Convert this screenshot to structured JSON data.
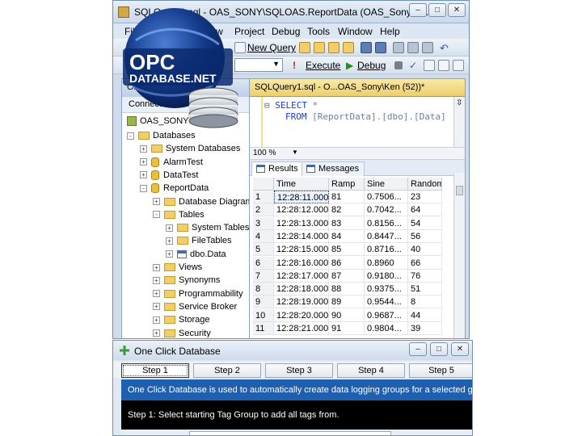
{
  "ssms": {
    "title": "SQLQuery1.sql - OAS_SONY\\SQLOAS.ReportData (OAS_Sony\\Ke...",
    "window_buttons": {
      "minimize": "–",
      "maximize": "□",
      "close": "✕"
    },
    "menu": [
      "File",
      "View",
      "Project",
      "Debug",
      "Tools",
      "Window",
      "Help"
    ],
    "toolbar1": {
      "new_query": "New Query"
    },
    "toolbar2": {
      "execute": "Execute",
      "debug": "Debug"
    },
    "object_explorer": {
      "header": "Object Explorer",
      "connect": "Connect",
      "server": "OAS_SONY\\SQLOAS",
      "tree": [
        {
          "label": "Databases",
          "indent": 0,
          "icon": "folder",
          "exp": "-"
        },
        {
          "label": "System Databases",
          "indent": 1,
          "icon": "folder",
          "exp": "+"
        },
        {
          "label": "AlarmTest",
          "indent": 1,
          "icon": "db",
          "exp": "+"
        },
        {
          "label": "DataTest",
          "indent": 1,
          "icon": "db",
          "exp": "+"
        },
        {
          "label": "ReportData",
          "indent": 1,
          "icon": "db",
          "exp": "-"
        },
        {
          "label": "Database Diagrams",
          "indent": 2,
          "icon": "folder",
          "exp": "+"
        },
        {
          "label": "Tables",
          "indent": 2,
          "icon": "folder",
          "exp": "-"
        },
        {
          "label": "System Tables",
          "indent": 3,
          "icon": "folder",
          "exp": "+"
        },
        {
          "label": "FileTables",
          "indent": 3,
          "icon": "folder",
          "exp": "+"
        },
        {
          "label": "dbo.Data",
          "indent": 3,
          "icon": "table",
          "exp": "+"
        },
        {
          "label": "Views",
          "indent": 2,
          "icon": "folder",
          "exp": "+"
        },
        {
          "label": "Synonyms",
          "indent": 2,
          "icon": "folder",
          "exp": "+"
        },
        {
          "label": "Programmability",
          "indent": 2,
          "icon": "folder",
          "exp": "+"
        },
        {
          "label": "Service Broker",
          "indent": 2,
          "icon": "folder",
          "exp": "+"
        },
        {
          "label": "Storage",
          "indent": 2,
          "icon": "folder",
          "exp": "+"
        },
        {
          "label": "Security",
          "indent": 2,
          "icon": "folder",
          "exp": "+"
        }
      ]
    },
    "query": {
      "tab": "SQLQuery1.sql - O...OAS_Sony\\Ken (52))*",
      "line1_kw": "SELECT",
      "line1_rest": " *",
      "line2_kw": "FROM",
      "line2_rest": " [ReportData].[dbo].[Data]",
      "zoom": "100 %"
    },
    "results": {
      "tabs": [
        "Results",
        "Messages"
      ],
      "columns": [
        "",
        "Time",
        "Ramp",
        "Sine",
        "Random"
      ],
      "rows": [
        [
          "1",
          "12:28:11.000",
          "81",
          "0.7506...",
          "23"
        ],
        [
          "2",
          "12:28:12.000",
          "82",
          "0.7042...",
          "64"
        ],
        [
          "3",
          "12:28:13.000",
          "83",
          "0.8156...",
          "54"
        ],
        [
          "4",
          "12:28:14.000",
          "84",
          "0.8447...",
          "56"
        ],
        [
          "5",
          "12:28:15.000",
          "85",
          "0.8716...",
          "40"
        ],
        [
          "6",
          "12:28:16.000",
          "86",
          "0.8960",
          "66"
        ],
        [
          "7",
          "12:28:17.000",
          "87",
          "0.9180...",
          "76"
        ],
        [
          "8",
          "12:28:18.000",
          "88",
          "0.9375...",
          "51"
        ],
        [
          "9",
          "12:28:19.000",
          "89",
          "0.9544...",
          "8"
        ],
        [
          "10",
          "12:28:20.000",
          "90",
          "0.9687...",
          "44"
        ],
        [
          "11",
          "12:28:21.000",
          "91",
          "0.9804...",
          "39"
        ]
      ]
    }
  },
  "logo": {
    "line1": "OPC",
    "line2": "DATABASE.NET"
  },
  "one_click": {
    "title": "One Click Database",
    "window_buttons": {
      "minimize": "–",
      "maximize": "□",
      "close": "✕"
    },
    "steps": [
      "Step 1",
      "Step 2",
      "Step 3",
      "Step 4",
      "Step 5"
    ],
    "info": "One Click Database is used to automatically create data logging groups for a selected group of tags",
    "prompt": "Step 1: Select starting Tag Group to add all tags from."
  },
  "colors": {
    "accent": "#1f5fb0",
    "logo_blue": "#0a2a6e"
  }
}
